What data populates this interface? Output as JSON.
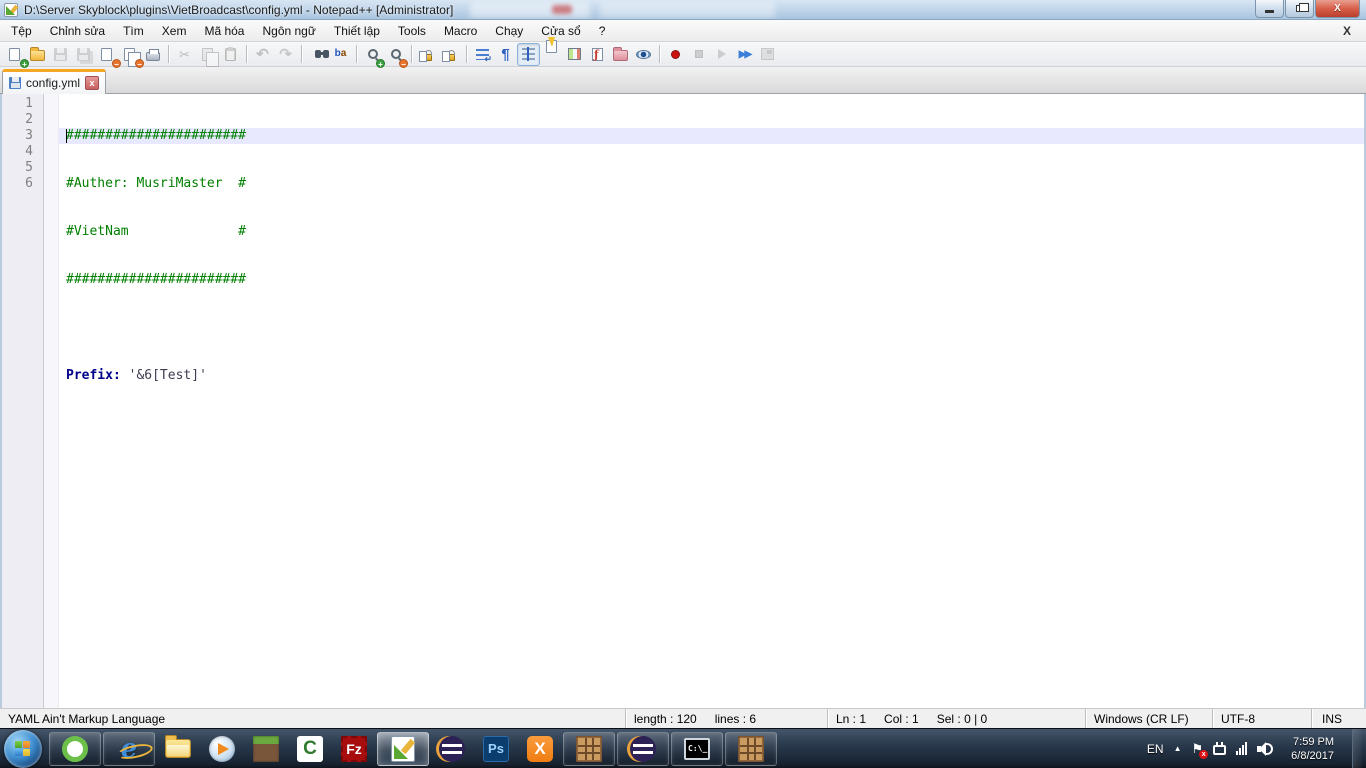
{
  "titlebar": {
    "title": "D:\\Server Skyblock\\plugins\\VietBroadcast\\config.yml - Notepad++ [Administrator]",
    "controls": {
      "minimize": "minimize",
      "restore": "restore",
      "close": "X"
    }
  },
  "menu": {
    "items": [
      "Tệp",
      "Chỉnh sửa",
      "Tìm",
      "Xem",
      "Mã hóa",
      "Ngôn ngữ",
      "Thiết lập",
      "Tools",
      "Macro",
      "Chạy",
      "Cửa sổ",
      "?"
    ],
    "mdi_close": "X"
  },
  "toolbar": {
    "icons": [
      "new-file",
      "open-file",
      "save",
      "save-all",
      "close-file",
      "close-all",
      "print",
      "cut",
      "copy",
      "paste",
      "undo",
      "redo",
      "find",
      "replace",
      "zoom-in",
      "zoom-out",
      "sync-vertical-scroll",
      "sync-horizontal-scroll",
      "word-wrap",
      "show-all-characters",
      "show-indent-guide",
      "user-defined-language",
      "document-map",
      "function-list",
      "folder-as-workspace",
      "monitoring",
      "macro-record",
      "macro-stop",
      "macro-play",
      "macro-run-multiple",
      "macro-save"
    ]
  },
  "tabbar": {
    "tabs": [
      {
        "label": "config.yml",
        "close": "x"
      }
    ]
  },
  "editor": {
    "lines": [
      {
        "num": "1",
        "text": "#######################"
      },
      {
        "num": "2",
        "text": "#Auther: MusriMaster  #"
      },
      {
        "num": "3",
        "text": "#VietNam              #"
      },
      {
        "num": "4",
        "text": "#######################"
      },
      {
        "num": "5",
        "text": ""
      },
      {
        "num": "6",
        "key": "Prefix:",
        "value": " '&6[Test]'"
      }
    ],
    "syntax_colors": {
      "comment": "#008000",
      "keyword": "#00008b",
      "current_line": "#e8e8ff"
    }
  },
  "statusbar": {
    "doc_type": "YAML Ain't Markup Language",
    "length": "length : 120",
    "lines": "lines : 6",
    "ln": "Ln : 1",
    "col": "Col : 1",
    "sel": "Sel : 0 | 0",
    "eol": "Windows (CR LF)",
    "encoding": "UTF-8",
    "insert_mode": "INS"
  },
  "taskbar": {
    "buttons": [
      {
        "name": "start-orb",
        "state": "pinned"
      },
      {
        "name": "coccoc-browser",
        "state": "running"
      },
      {
        "name": "internet-explorer",
        "state": "running"
      },
      {
        "name": "windows-explorer",
        "state": "pinned"
      },
      {
        "name": "windows-media-player",
        "state": "pinned"
      },
      {
        "name": "minecraft",
        "state": "pinned"
      },
      {
        "name": "camtasia",
        "state": "pinned"
      },
      {
        "name": "filezilla",
        "state": "pinned"
      },
      {
        "name": "notepad-plus-plus",
        "state": "active"
      },
      {
        "name": "eclipse",
        "state": "pinned"
      },
      {
        "name": "photoshop",
        "state": "pinned"
      },
      {
        "name": "xampp",
        "state": "pinned"
      },
      {
        "name": "minecraft-server-1",
        "state": "running"
      },
      {
        "name": "eclipse-window",
        "state": "running"
      },
      {
        "name": "command-prompt",
        "state": "running"
      },
      {
        "name": "minecraft-server-2",
        "state": "running"
      }
    ],
    "photoshop_label": "Ps",
    "filezilla_label": "Fz",
    "xampp_label": "X",
    "camtasia_label": "C",
    "cmd_label": "C:\\_",
    "tray": {
      "language": "EN",
      "time": "7:59 PM",
      "date": "6/8/2017",
      "icons": [
        "hidden-icons-arrow",
        "action-center-flag",
        "power-plug",
        "network-signal",
        "volume-speaker"
      ]
    }
  }
}
